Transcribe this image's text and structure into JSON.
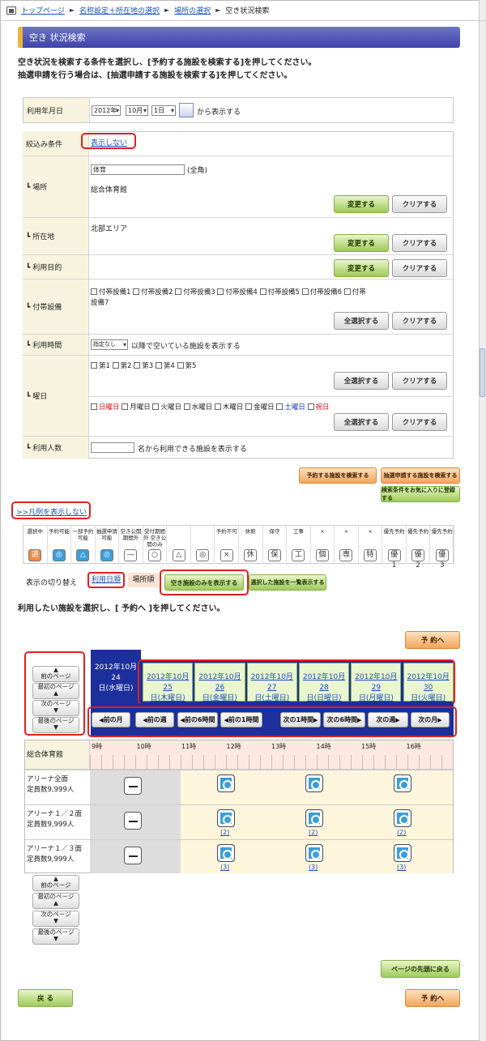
{
  "breadcrumb": {
    "home": "トップページ",
    "step2": "名称設定＋所在地の選択",
    "step3": "場所の選択",
    "current": "空き状況検索"
  },
  "page_title": "空き 状況検索",
  "intro": {
    "line1": "空き状況を検索する条件を選択し、[予約する施設を検索する]を押してください。",
    "line2": "抽選申請を行う場合は、[抽選申請する施設を検索する]を押してください。"
  },
  "date_row": {
    "label": "利用年月日",
    "year": "2012年",
    "month": "10月",
    "day": "1日",
    "suffix": "から表示する"
  },
  "filter": {
    "label": "絞込み条件",
    "toggle": "表示しない"
  },
  "place": {
    "label": "┗ 場所",
    "input": "体育",
    "input_note": "(全角)",
    "value": "総合体育館",
    "change": "変更する",
    "clear": "クリアする"
  },
  "location": {
    "label": "┗ 所在地",
    "value": "北部エリア",
    "change": "変更する",
    "clear": "クリアする"
  },
  "purpose": {
    "label": "┗ 利用目的",
    "change": "変更する",
    "clear": "クリアする"
  },
  "equipment": {
    "label": "┗ 付帯設備",
    "items": [
      "付帯設備1",
      "付帯設備2",
      "付帯設備3",
      "付帯設備4",
      "付帯設備5",
      "付帯設備6",
      "付帯"
    ],
    "cont": "設備7",
    "select_all": "全選択する",
    "clear": "クリアする"
  },
  "time": {
    "label": "┗ 利用時間",
    "select": "指定なし",
    "suffix": "以降で空いている施設を表示する"
  },
  "weekday": {
    "label": "┗ 曜日",
    "weeks": [
      "第1",
      "第2",
      "第3",
      "第4",
      "第5"
    ],
    "days": [
      "日曜日",
      "月曜日",
      "火曜日",
      "水曜日",
      "木曜日",
      "金曜日",
      "土曜日",
      "祝日"
    ],
    "select_all": "全選択する",
    "clear": "クリアする"
  },
  "people": {
    "label": "┗ 利用人数",
    "suffix": "名から利用できる施設を表示する"
  },
  "actions": {
    "search": "予約する施設を検索する",
    "lottery": "抽選申請する施設を検索する",
    "favorite": "検索条件をお気に入りに登録する"
  },
  "legend_toggle": ">>凡例を表示しない",
  "legend": [
    {
      "t": "選択中",
      "i": "選"
    },
    {
      "t": "予約可能",
      "i": "◎"
    },
    {
      "t": "一部予約可能",
      "i": "△"
    },
    {
      "t": "抽選申請可能",
      "i": "◎"
    },
    {
      "t": "空き公開期間外",
      "i": "―"
    },
    {
      "t": "受付期間外 空き公開のみ",
      "i": "○"
    },
    {
      "t": "",
      "i": "△"
    },
    {
      "t": "",
      "i": "◎"
    },
    {
      "t": "予約不可",
      "i": "×"
    },
    {
      "t": "休館",
      "i": "休"
    },
    {
      "t": "保守",
      "i": "保"
    },
    {
      "t": "工事",
      "i": "工"
    },
    {
      "t": "×",
      "i": "個"
    },
    {
      "t": "×",
      "i": "専"
    },
    {
      "t": "×",
      "i": "特"
    },
    {
      "t": "優先予約",
      "i": "優1"
    },
    {
      "t": "優先予約",
      "i": "優2"
    },
    {
      "t": "優先予約",
      "i": "優3"
    }
  ],
  "view_switch": {
    "label": "表示の切り替え",
    "by_date": "利用日順",
    "by_place": "場所順",
    "only_free": "空き施設のみを表示する",
    "list_selected": "選択した施設を一覧表示する"
  },
  "select_prompt": "利用したい施設を選択し、[ 予約へ ]を押してください。",
  "reserve": "予 約へ",
  "pager": {
    "prev": "前のページ",
    "first": "最初のページ",
    "next": "次のページ",
    "last": "最後のページ"
  },
  "calendar": {
    "current": [
      "2012年10月24",
      "日(水曜日)"
    ],
    "dates": [
      [
        "2012年10月25",
        "日(木曜日)"
      ],
      [
        "2012年10月26",
        "日(金曜日)"
      ],
      [
        "2012年10月27",
        "日(土曜日)"
      ],
      [
        "2012年10月28",
        "日(日曜日)"
      ],
      [
        "2012年10月29",
        "日(月曜日)"
      ],
      [
        "2012年10月30",
        "日(火曜日)"
      ]
    ],
    "nav": [
      "前の月",
      "前の週",
      "前の6時間",
      "前の1時間",
      "次の1時間",
      "次の6時間",
      "次の週",
      "次の月"
    ]
  },
  "grid": {
    "facility": "総合体育館",
    "hours": [
      "9時",
      "10時",
      "11時",
      "12時",
      "13時",
      "14時",
      "15時",
      "16時"
    ],
    "rows": [
      {
        "name": "アリーナ全面",
        "cap": "定員数9,999人",
        "cnt": ""
      },
      {
        "name": "アリーナ１／２面",
        "cap": "定員数9,999人",
        "cnt": "(2)"
      },
      {
        "name": "アリーナ１／３面",
        "cap": "定員数9,999人",
        "cnt": "(3)"
      }
    ]
  },
  "back": "戻 る",
  "to_top": "ページの先頭に戻る"
}
